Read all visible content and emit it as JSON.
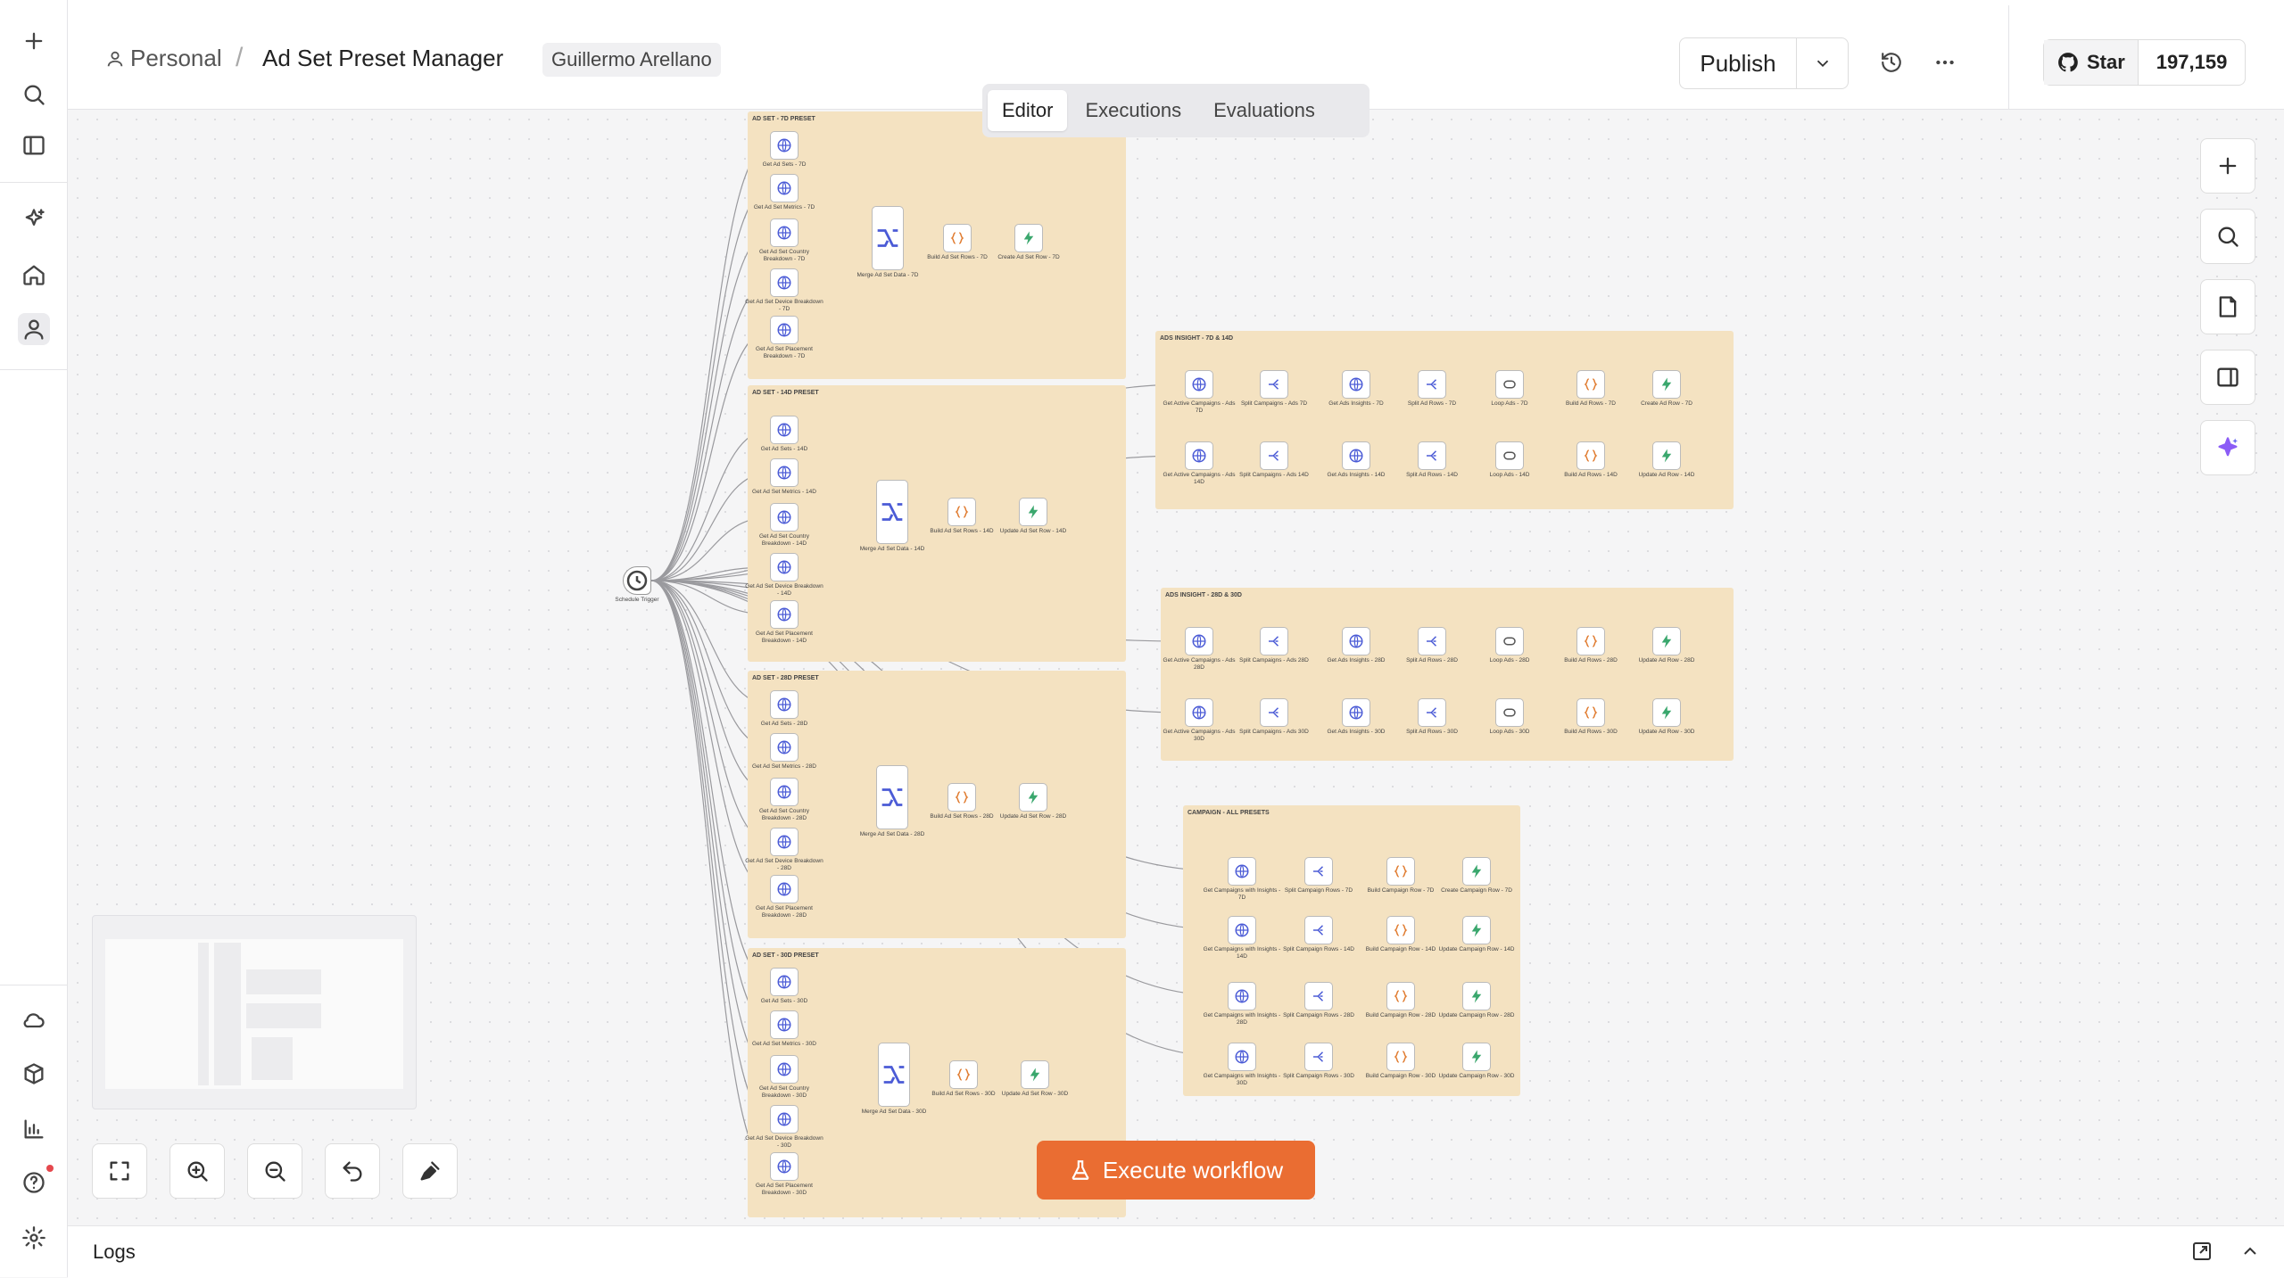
{
  "header": {
    "project": "Personal",
    "workflow_title": "Ad Set Preset Manager",
    "owner": "Guillermo Arellano",
    "publish_label": "Publish",
    "github_star_label": "Star",
    "github_star_count": "197,159"
  },
  "tabs": [
    {
      "label": "Editor",
      "active": true
    },
    {
      "label": "Executions",
      "active": false
    },
    {
      "label": "Evaluations",
      "active": false
    }
  ],
  "trigger": {
    "label": "Schedule Trigger"
  },
  "groups": [
    {
      "title": "AD SET - 7D PRESET",
      "inputs": [
        "Get Ad Sets - 7D",
        "Get Ad Set Metrics - 7D",
        "Get Ad Set Country Breakdown - 7D",
        "Get Ad Set Device Breakdown - 7D",
        "Get Ad Set Placement Breakdown - 7D"
      ],
      "merge": "Merge Ad Set Data - 7D",
      "build": "Build Ad Set Rows - 7D",
      "write": "Create Ad Set Row - 7D"
    },
    {
      "title": "AD SET - 14D PRESET",
      "inputs": [
        "Get Ad Sets - 14D",
        "Get Ad Set Metrics - 14D",
        "Get Ad Set Country Breakdown - 14D",
        "Get Ad Set Device Breakdown - 14D",
        "Get Ad Set Placement Breakdown - 14D"
      ],
      "merge": "Merge Ad Set Data - 14D",
      "build": "Build Ad Set Rows - 14D",
      "write": "Update Ad Set Row - 14D"
    },
    {
      "title": "AD SET - 28D PRESET",
      "inputs": [
        "Get Ad Sets - 28D",
        "Get Ad Set Metrics - 28D",
        "Get Ad Set Country Breakdown - 28D",
        "Get Ad Set Device Breakdown - 28D",
        "Get Ad Set Placement Breakdown - 28D"
      ],
      "merge": "Merge Ad Set Data - 28D",
      "build": "Build Ad Set Rows - 28D",
      "write": "Update Ad Set Row - 28D"
    },
    {
      "title": "AD SET - 30D PRESET",
      "inputs": [
        "Get Ad Sets - 30D",
        "Get Ad Set Metrics - 30D",
        "Get Ad Set Country Breakdown - 30D",
        "Get Ad Set Device Breakdown - 30D",
        "Get Ad Set Placement Breakdown - 30D"
      ],
      "merge": "Merge Ad Set Data - 30D",
      "build": "Build Ad Set Rows - 30D",
      "write": "Update Ad Set Row - 30D"
    }
  ],
  "ads_groups": [
    {
      "title": "ADS INSIGHT - 7D & 14D",
      "rows": [
        [
          "Get Active Campaigns - Ads 7D",
          "Split Campaigns - Ads 7D",
          "Get Ads Insights - 7D",
          "Split Ad Rows - 7D",
          "Loop Ads - 7D",
          "Build Ad Rows - 7D",
          "Create Ad Row - 7D"
        ],
        [
          "Get Active Campaigns - Ads 14D",
          "Split Campaigns - Ads 14D",
          "Get Ads Insights - 14D",
          "Split Ad Rows - 14D",
          "Loop Ads - 14D",
          "Build Ad Rows - 14D",
          "Update Ad Row - 14D"
        ]
      ]
    },
    {
      "title": "ADS INSIGHT - 28D & 30D",
      "rows": [
        [
          "Get Active Campaigns - Ads 28D",
          "Split Campaigns - Ads 28D",
          "Get Ads Insights - 28D",
          "Split Ad Rows - 28D",
          "Loop Ads - 28D",
          "Build Ad Rows - 28D",
          "Update Ad Row - 28D"
        ],
        [
          "Get Active Campaigns - Ads 30D",
          "Split Campaigns - Ads 30D",
          "Get Ads Insights - 30D",
          "Split Ad Rows - 30D",
          "Loop Ads - 30D",
          "Build Ad Rows - 30D",
          "Update Ad Row - 30D"
        ]
      ]
    }
  ],
  "campaign_group": {
    "title": "CAMPAIGN - ALL PRESETS",
    "rows": [
      [
        "Get Campaigns with Insights - 7D",
        "Split Campaign Rows - 7D",
        "Build Campaign Row - 7D",
        "Create Campaign Row - 7D"
      ],
      [
        "Get Campaigns with Insights - 14D",
        "Split Campaign Rows - 14D",
        "Build Campaign Row - 14D",
        "Update Campaign Row - 14D"
      ],
      [
        "Get Campaigns with Insights - 28D",
        "Split Campaign Rows - 28D",
        "Build Campaign Row - 28D",
        "Update Campaign Row - 28D"
      ],
      [
        "Get Campaigns with Insights - 30D",
        "Split Campaign Rows - 30D",
        "Build Campaign Row - 30D",
        "Update Campaign Row - 30D"
      ]
    ]
  },
  "execute_label": "Execute workflow",
  "logs_label": "Logs",
  "colors": {
    "accent": "#ea6d32",
    "group_bg": "#f4e2c1",
    "http_icon": "#4b5bd6",
    "code_icon": "#e07b2f",
    "sheets_icon": "#3aa76d"
  }
}
